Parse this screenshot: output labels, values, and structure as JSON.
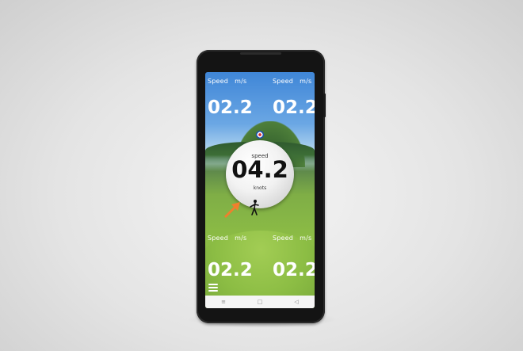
{
  "metrics": {
    "top_left": {
      "label": "Speed",
      "unit": "m/s",
      "value": "02.2"
    },
    "top_right": {
      "label": "Speed",
      "unit": "m/s",
      "value": "02.2"
    },
    "bottom_left": {
      "label": "Speed",
      "unit": "m/s",
      "value": "02.2"
    },
    "bottom_right": {
      "label": "Speed",
      "unit": "m/s",
      "value": "02.2"
    }
  },
  "center_gauge": {
    "label": "speed",
    "value": "04.2",
    "unit": "knots"
  },
  "nav": {
    "recents_icon": "≡",
    "home_icon": "□",
    "back_icon": "◁"
  },
  "colors": {
    "arrow": "#f07f2d",
    "target_center": "#d42a2a",
    "target_ring": "#1d4fb0"
  }
}
